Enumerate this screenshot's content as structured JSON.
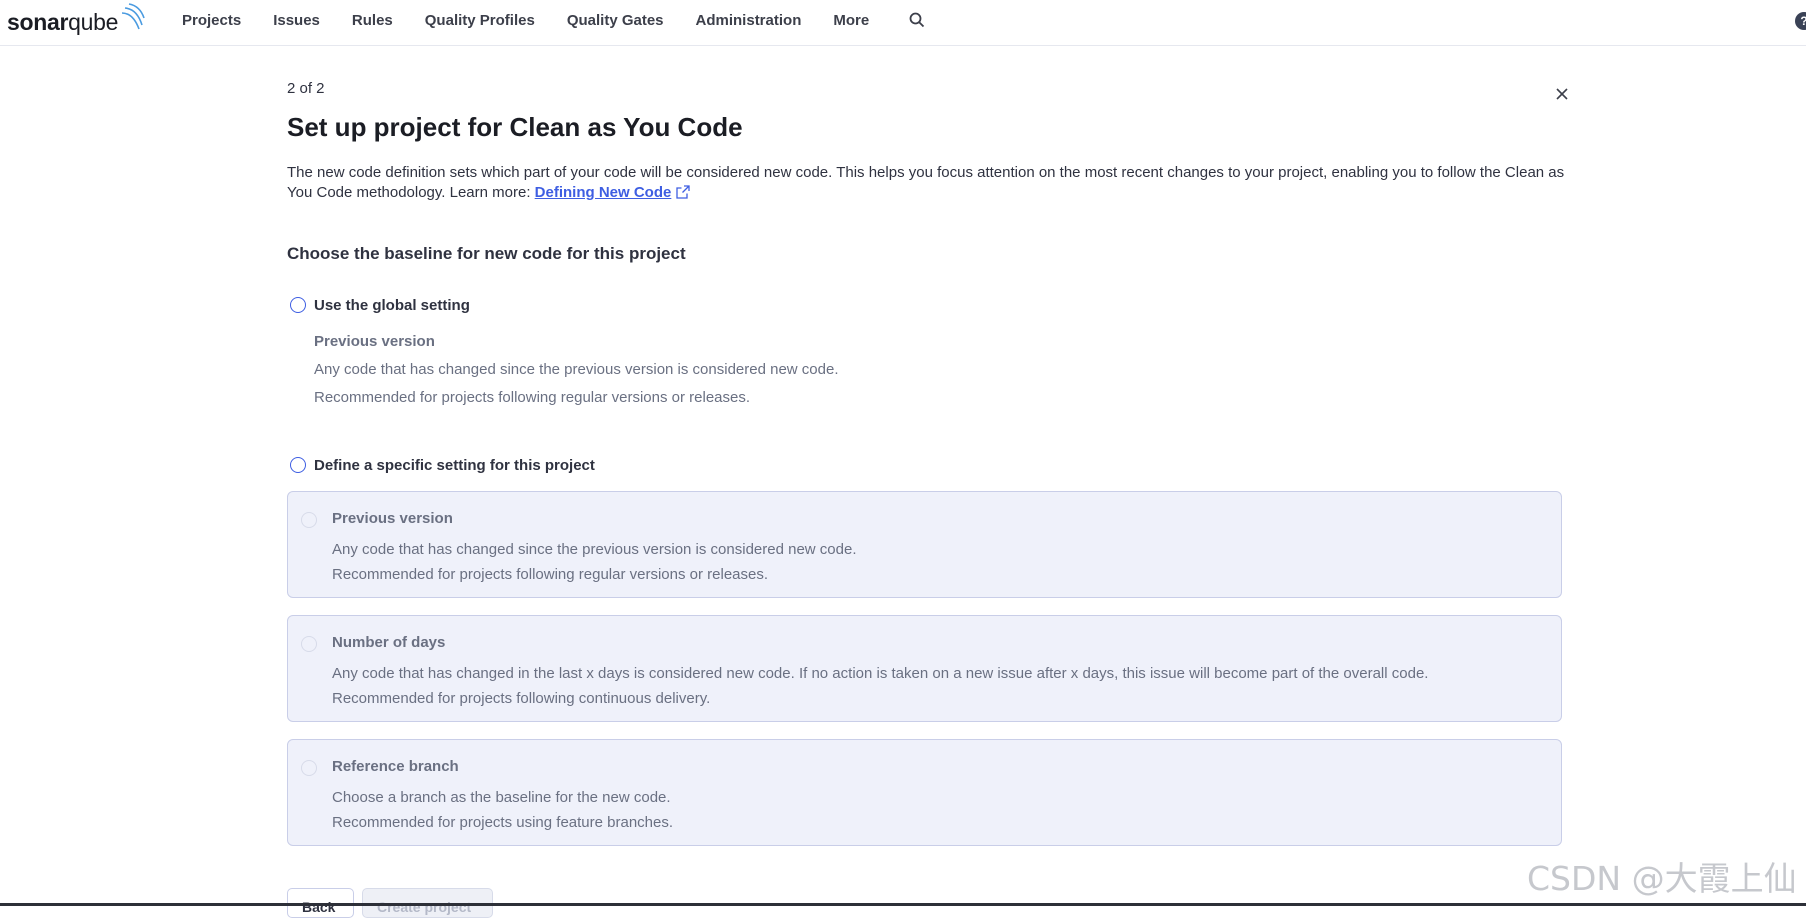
{
  "nav": {
    "logo_bold": "sonar",
    "logo_thin": "qube",
    "items": [
      "Projects",
      "Issues",
      "Rules",
      "Quality Profiles",
      "Quality Gates",
      "Administration",
      "More"
    ],
    "help_label": "?"
  },
  "page": {
    "step": "2 of 2",
    "title": "Set up project for Clean as You Code",
    "description": "The new code definition sets which part of your code will be considered new code. This helps you focus attention on the most recent changes to your project, enabling you to follow the Clean as You Code methodology. Learn more:",
    "link_text": "Defining New Code",
    "subtitle": "Choose the baseline for new code for this project"
  },
  "global_option": {
    "label": "Use the global setting",
    "info_title": "Previous version",
    "info_line1": "Any code that has changed since the previous version is considered new code.",
    "info_line2": "Recommended for projects following regular versions or releases."
  },
  "specific_option": {
    "label": "Define a specific setting for this project",
    "choices": [
      {
        "title": "Previous version",
        "line1": "Any code that has changed since the previous version is considered new code.",
        "line2": "Recommended for projects following regular versions or releases."
      },
      {
        "title": "Number of days",
        "line1": "Any code that has changed in the last x days is considered new code. If no action is taken on a new issue after x days, this issue will become part of the overall code.",
        "line2": "Recommended for projects following continuous delivery."
      },
      {
        "title": "Reference branch",
        "line1": "Choose a branch as the baseline for the new code.",
        "line2": "Recommended for projects using feature branches."
      }
    ]
  },
  "buttons": {
    "back": "Back",
    "create": "Create project"
  },
  "watermark": "CSDN @大霞上仙",
  "colors": {
    "accent": "#3e5ee2",
    "card_bg": "#eff1fa",
    "card_border": "#c9cee8"
  }
}
